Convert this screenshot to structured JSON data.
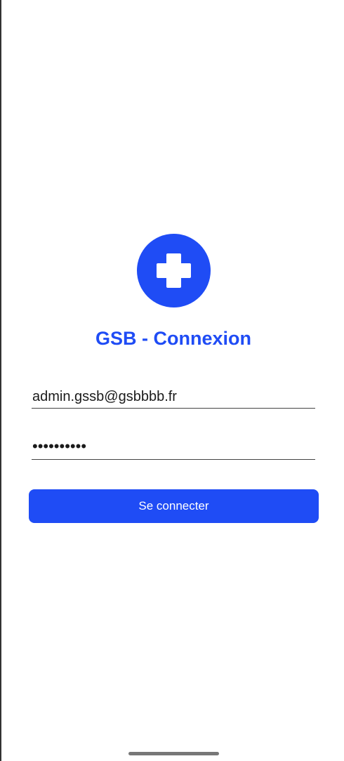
{
  "app": {
    "title": "GSB - Connexion"
  },
  "form": {
    "email_value": "admin.gssb@gsbbbb.fr",
    "password_value": "••••••••••",
    "submit_label": "Se connecter"
  },
  "colors": {
    "accent": "#1f4cf5",
    "background": "#ffffff"
  },
  "icons": {
    "logo": "medical-cross-icon"
  }
}
